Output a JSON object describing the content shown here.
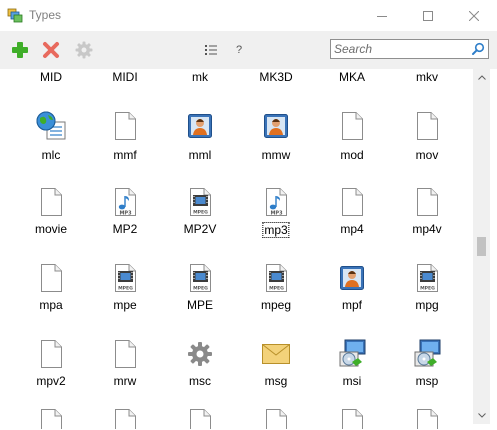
{
  "window": {
    "title": "Types",
    "minimize_label": "—",
    "maximize_label": "☐",
    "close_label": "✕"
  },
  "toolbar": {
    "add_icon": "plus-icon",
    "delete_icon": "delete-x-icon",
    "settings_icon": "gear-icon",
    "list_icon": "list-icon",
    "help_label": "?",
    "search_placeholder": "Search",
    "search_icon": "magnifier-icon"
  },
  "header_row": [
    "MID",
    "MIDI",
    "mk",
    "MK3D",
    "MKA",
    "mkv"
  ],
  "rows": [
    [
      {
        "label": "mlc",
        "icon": "globe-settings"
      },
      {
        "label": "mmf",
        "icon": "blank"
      },
      {
        "label": "mml",
        "icon": "person"
      },
      {
        "label": "mmw",
        "icon": "person"
      },
      {
        "label": "mod",
        "icon": "blank"
      },
      {
        "label": "mov",
        "icon": "blank"
      }
    ],
    [
      {
        "label": "movie",
        "icon": "blank"
      },
      {
        "label": "MP2",
        "icon": "mp3"
      },
      {
        "label": "MP2V",
        "icon": "mpeg"
      },
      {
        "label": "mp3",
        "icon": "mp3",
        "selected": true
      },
      {
        "label": "mp4",
        "icon": "blank"
      },
      {
        "label": "mp4v",
        "icon": "blank"
      }
    ],
    [
      {
        "label": "mpa",
        "icon": "blank"
      },
      {
        "label": "mpe",
        "icon": "mpeg"
      },
      {
        "label": "MPE",
        "icon": "mpeg"
      },
      {
        "label": "mpeg",
        "icon": "mpeg"
      },
      {
        "label": "mpf",
        "icon": "person"
      },
      {
        "label": "mpg",
        "icon": "mpeg"
      }
    ],
    [
      {
        "label": "mpv2",
        "icon": "blank"
      },
      {
        "label": "mrw",
        "icon": "blank"
      },
      {
        "label": "msc",
        "icon": "gear"
      },
      {
        "label": "msg",
        "icon": "envelope"
      },
      {
        "label": "msi",
        "icon": "installer"
      },
      {
        "label": "msp",
        "icon": "installer"
      }
    ]
  ],
  "partial_row_icons": [
    "blank",
    "blank",
    "blank",
    "blank",
    "blank",
    "blank"
  ],
  "badge_text": {
    "mp3": "MP3",
    "mpeg": "MPEG"
  },
  "colors": {
    "toolbar_bg": "#f0f0f0",
    "add_green": "#3fae29",
    "delete_red": "#e86a5e",
    "folder_blue": "#2e7ec9"
  }
}
